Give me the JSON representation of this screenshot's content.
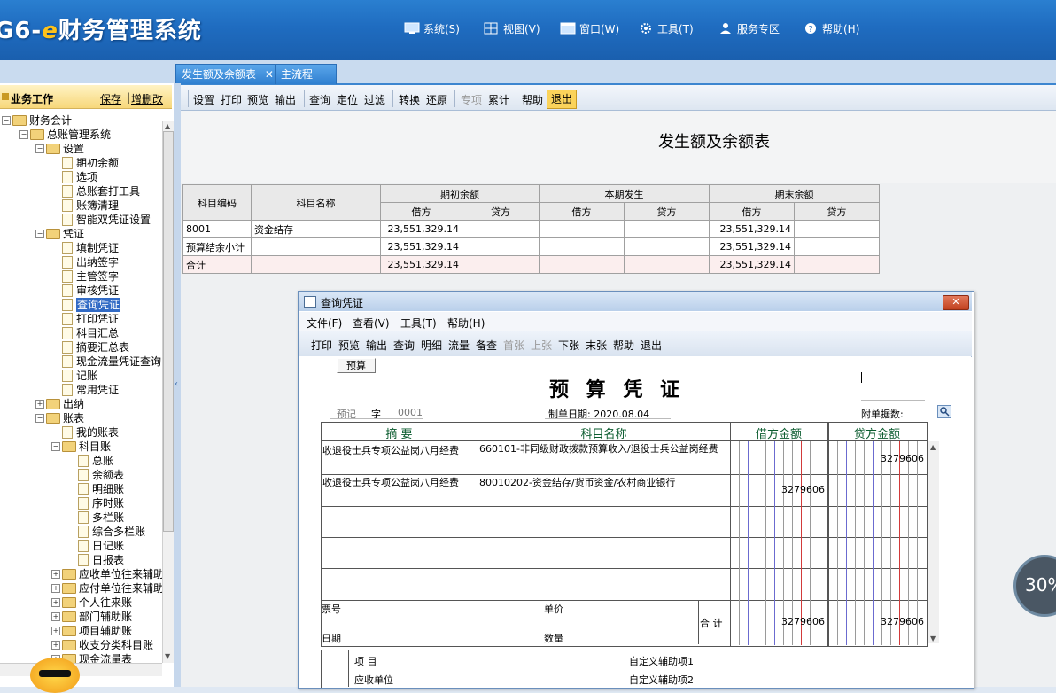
{
  "app": {
    "title_prefix": "G6-",
    "title_e": "e",
    "title_main": "财务管理系统",
    "menu": [
      {
        "label": "系统(S)",
        "icon": "monitor-icon"
      },
      {
        "label": "视图(V)",
        "icon": "grid-icon"
      },
      {
        "label": "窗口(W)",
        "icon": "window-icon"
      },
      {
        "label": "工具(T)",
        "icon": "gear-icon"
      },
      {
        "label": "服务专区",
        "icon": "user-icon"
      },
      {
        "label": "帮助(H)",
        "icon": "help-icon"
      }
    ]
  },
  "tabs": [
    {
      "label": "发生额及余额表",
      "close": "✕"
    },
    {
      "label": "主流程"
    }
  ],
  "left_panel": {
    "title": "业务工作",
    "save": "保存",
    "add_delete": "增删改",
    "tree": [
      {
        "label": "财务会计",
        "level": 0,
        "type": "folder",
        "pm": "−"
      },
      {
        "label": "总账管理系统",
        "level": 1,
        "type": "folder",
        "pm": "−"
      },
      {
        "label": "设置",
        "level": 2,
        "type": "folder",
        "pm": "−"
      },
      {
        "label": "期初余额",
        "level": 3,
        "type": "doc"
      },
      {
        "label": "选项",
        "level": 3,
        "type": "doc"
      },
      {
        "label": "总账套打工具",
        "level": 3,
        "type": "doc"
      },
      {
        "label": "账簿清理",
        "level": 3,
        "type": "doc"
      },
      {
        "label": "智能双凭证设置",
        "level": 3,
        "type": "doc"
      },
      {
        "label": "凭证",
        "level": 2,
        "type": "folder",
        "pm": "−"
      },
      {
        "label": "填制凭证",
        "level": 3,
        "type": "doc"
      },
      {
        "label": "出纳签字",
        "level": 3,
        "type": "doc"
      },
      {
        "label": "主管签字",
        "level": 3,
        "type": "doc"
      },
      {
        "label": "审核凭证",
        "level": 3,
        "type": "doc"
      },
      {
        "label": "查询凭证",
        "level": 3,
        "type": "doc",
        "selected": true
      },
      {
        "label": "打印凭证",
        "level": 3,
        "type": "doc"
      },
      {
        "label": "科目汇总",
        "level": 3,
        "type": "doc"
      },
      {
        "label": "摘要汇总表",
        "level": 3,
        "type": "doc"
      },
      {
        "label": "现金流量凭证查询",
        "level": 3,
        "type": "doc"
      },
      {
        "label": "记账",
        "level": 3,
        "type": "doc"
      },
      {
        "label": "常用凭证",
        "level": 3,
        "type": "doc"
      },
      {
        "label": "出纳",
        "level": 2,
        "type": "folder",
        "pm": "+"
      },
      {
        "label": "账表",
        "level": 2,
        "type": "folder",
        "pm": "−"
      },
      {
        "label": "我的账表",
        "level": 3,
        "type": "doc"
      },
      {
        "label": "科目账",
        "level": 3,
        "type": "folder",
        "pm": "−"
      },
      {
        "label": "总账",
        "level": 4,
        "type": "doc"
      },
      {
        "label": "余额表",
        "level": 4,
        "type": "doc"
      },
      {
        "label": "明细账",
        "level": 4,
        "type": "doc"
      },
      {
        "label": "序时账",
        "level": 4,
        "type": "doc"
      },
      {
        "label": "多栏账",
        "level": 4,
        "type": "doc"
      },
      {
        "label": "综合多栏账",
        "level": 4,
        "type": "doc"
      },
      {
        "label": "日记账",
        "level": 4,
        "type": "doc"
      },
      {
        "label": "日报表",
        "level": 4,
        "type": "doc"
      },
      {
        "label": "应收单位往来辅助",
        "level": 3,
        "type": "folder",
        "pm": "+"
      },
      {
        "label": "应付单位往来辅助",
        "level": 3,
        "type": "folder",
        "pm": "+"
      },
      {
        "label": "个人往来账",
        "level": 3,
        "type": "folder",
        "pm": "+"
      },
      {
        "label": "部门辅助账",
        "level": 3,
        "type": "folder",
        "pm": "+"
      },
      {
        "label": "项目辅助账",
        "level": 3,
        "type": "folder",
        "pm": "+"
      },
      {
        "label": "收支分类科目账",
        "level": 3,
        "type": "folder",
        "pm": "+"
      },
      {
        "label": "现金流量表",
        "level": 3,
        "type": "folder",
        "pm": "+"
      }
    ]
  },
  "toolbar": {
    "items": [
      {
        "label": "设置"
      },
      {
        "label": "打印"
      },
      {
        "label": "预览"
      },
      {
        "label": "输出"
      },
      {
        "label": "查询"
      },
      {
        "label": "定位"
      },
      {
        "label": "过滤"
      },
      {
        "label": "转换"
      },
      {
        "label": "还原"
      },
      {
        "label": "专项",
        "disabled": true
      },
      {
        "label": "累计"
      },
      {
        "label": "帮助"
      }
    ],
    "exit": "退出"
  },
  "report": {
    "title": "发生额及余额表",
    "headers": {
      "code": "科目编码",
      "name": "科目名称",
      "opening": "期初余额",
      "period": "本期发生",
      "closing": "期末余额",
      "debit": "借方",
      "credit": "贷方"
    },
    "rows": [
      {
        "code": "8001",
        "name": "资金结存",
        "open_debit": "23,551,329.14",
        "open_credit": "",
        "per_debit": "",
        "per_credit": "",
        "close_debit": "23,551,329.14",
        "close_credit": ""
      },
      {
        "code": "预算结余小计",
        "name": "",
        "open_debit": "23,551,329.14",
        "open_credit": "",
        "per_debit": "",
        "per_credit": "",
        "close_debit": "23,551,329.14",
        "close_credit": ""
      },
      {
        "code": "合计",
        "name": "",
        "open_debit": "23,551,329.14",
        "open_credit": "",
        "per_debit": "",
        "per_credit": "",
        "close_debit": "23,551,329.14",
        "close_credit": ""
      }
    ]
  },
  "dialog": {
    "title": "查询凭证",
    "close": "✕",
    "menu": [
      "文件(F)",
      "查看(V)",
      "工具(T)",
      "帮助(H)"
    ],
    "toolbar": [
      {
        "label": "打印"
      },
      {
        "label": "预览"
      },
      {
        "label": "输出"
      },
      {
        "label": "查询"
      },
      {
        "label": "明细"
      },
      {
        "label": "流量"
      },
      {
        "label": "备查"
      },
      {
        "label": "首张",
        "disabled": true
      },
      {
        "label": "上张",
        "disabled": true
      },
      {
        "label": "下张"
      },
      {
        "label": "末张"
      },
      {
        "label": "帮助"
      },
      {
        "label": "退出"
      }
    ],
    "budget_button": "预算",
    "voucher_title": "预 算 凭 证",
    "word_label": "预记",
    "zi": "字",
    "number": "0001",
    "date_label": "制单日期: 2020.08.04",
    "attachments_label": "附单据数:",
    "col_summary": "摘 要",
    "col_account": "科目名称",
    "col_debit": "借方金额",
    "col_credit": "贷方金额",
    "entries": [
      {
        "summary": "收退役士兵专项公益岗八月经费",
        "account": "660101-非同级财政拨款预算收入/退役士兵公益岗经费",
        "debit": "",
        "credit": "3279606"
      },
      {
        "summary": "收退役士兵专项公益岗八月经费",
        "account": "80010202-资金结存/货币资金/农村商业银行",
        "debit": "3279606",
        "credit": ""
      }
    ],
    "ticket_no": "票号",
    "date": "日期",
    "unit_price": "单价",
    "quantity": "数量",
    "total": "合 计",
    "total_debit": "3279606",
    "total_credit": "3279606",
    "project": "项    目",
    "receivable_unit": "应收单位",
    "custom_aux1": "自定义辅助项1",
    "custom_aux2": "自定义辅助项2"
  },
  "overlay": {
    "percent": "30%"
  }
}
